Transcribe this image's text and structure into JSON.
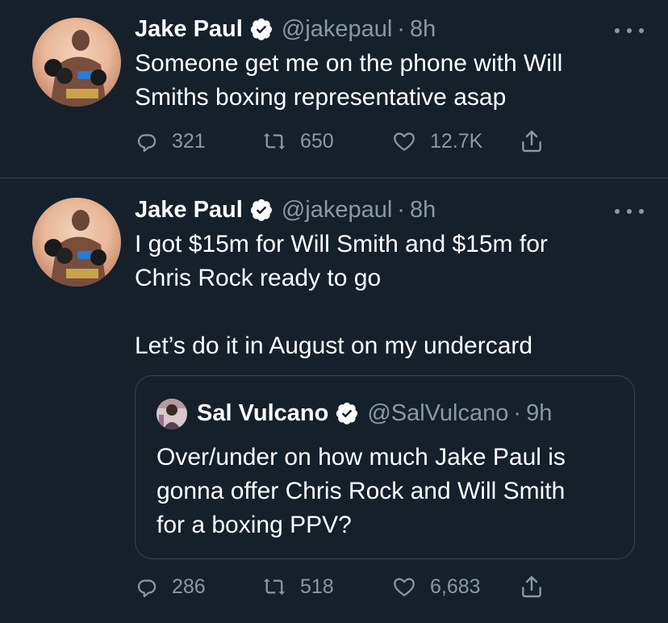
{
  "tweets": [
    {
      "author": {
        "name": "Jake Paul",
        "handle": "@jakepaul",
        "verified": true,
        "avatar_icon": "boxer-avatar"
      },
      "separator": "·",
      "time": "8h",
      "text": "Someone get me on the phone with Will\nSmiths boxing representative asap",
      "stats": {
        "replies": "321",
        "retweets": "650",
        "likes": "12.7K"
      }
    },
    {
      "author": {
        "name": "Jake Paul",
        "handle": "@jakepaul",
        "verified": true,
        "avatar_icon": "boxer-avatar"
      },
      "separator": "·",
      "time": "8h",
      "text": "I got $15m for Will Smith and $15m for\nChris Rock ready to go\n\nLet’s do it in August on my undercard",
      "quoted_tweet": {
        "author": {
          "name": "Sal Vulcano",
          "handle": "@SalVulcano",
          "verified": true,
          "avatar_icon": "person-avatar"
        },
        "separator": "·",
        "time": "9h",
        "text": "Over/under on how much Jake Paul is\ngonna offer Chris Rock and Will Smith\nfor a boxing PPV?"
      },
      "stats": {
        "replies": "286",
        "retweets": "518",
        "likes": "6,683"
      }
    }
  ],
  "colors": {
    "background": "#15202b",
    "primary_text": "#ffffff",
    "secondary_text": "#8899a6",
    "border": "#38444d",
    "verified_badge": "#ffffff"
  }
}
